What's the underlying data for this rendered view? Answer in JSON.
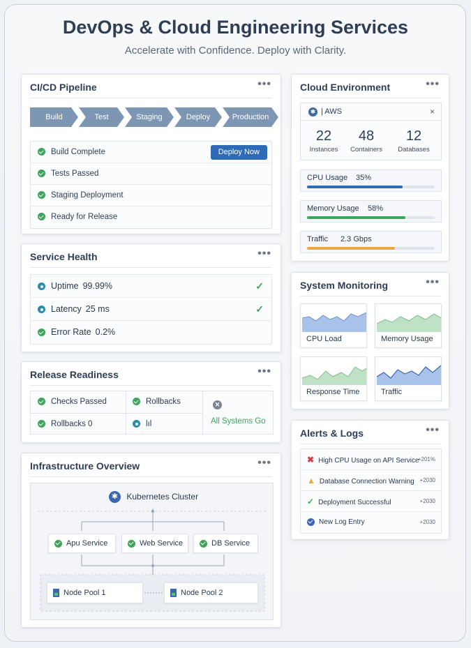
{
  "header": {
    "title": "DevOps & Cloud Engineering Services",
    "subtitle": "Accelerate with Confidence. Deploy with Clarity."
  },
  "pipeline": {
    "title": "CI/CD Pipeline",
    "stages": [
      "Build",
      "Test",
      "Staging",
      "Deploy",
      "Production"
    ],
    "steps": [
      "Build Complete",
      "Tests Passed",
      "Staging Deployment",
      "Ready for Release"
    ],
    "deploy_button": "Deploy Now"
  },
  "health": {
    "title": "Service Health",
    "items": [
      {
        "label": "Uptime",
        "value": "99.99%"
      },
      {
        "label": "Latency",
        "value": "25 ms"
      },
      {
        "label": "Error Rate",
        "value": "0.2%"
      }
    ]
  },
  "release": {
    "title": "Release Readiness",
    "checks_passed": "Checks Passed",
    "rollbacks_label": "Rollbacks",
    "rollbacks_count": "Rollbacks 0",
    "unknown": "lıl",
    "status": "All Systems Go"
  },
  "infra": {
    "title": "Infrastructure Overview",
    "cluster": "Kubernetes Cluster",
    "services": [
      "Apu Service",
      "Web Service",
      "DB Service"
    ],
    "pools": [
      "Node Pool 1",
      "Node Pool 2"
    ]
  },
  "cloud": {
    "title": "Cloud Environment",
    "provider": "| AWS",
    "close": "×",
    "stats": [
      {
        "value": "22",
        "label": "Instances"
      },
      {
        "value": "48",
        "label": "Containers"
      },
      {
        "value": "12",
        "label": "Databases"
      }
    ],
    "usage": [
      {
        "label": "CPU Usage",
        "value": "35%",
        "fill": 0.75,
        "color": "#2f6bb5"
      },
      {
        "label": "Memory Usage",
        "value": "58%",
        "fill": 0.77,
        "color": "#3fa45b"
      },
      {
        "label": "Traffic",
        "value": "2.3 Gbps",
        "fill": 0.69,
        "color": "#e9a93c"
      }
    ]
  },
  "monitoring": {
    "title": "System Monitoring",
    "tiles": [
      "CPU Load",
      "Memory Usage",
      "Response Time",
      "Traffic"
    ]
  },
  "alerts": {
    "title": "Alerts & Logs",
    "items": [
      {
        "text": "High CPU Usage on API Service",
        "time": "+201%"
      },
      {
        "text": "Database Connection Warning",
        "time": "+2030"
      },
      {
        "text": "Deployment Successful",
        "time": "+2030"
      },
      {
        "text": "New Log Entry",
        "time": "+2030"
      }
    ]
  },
  "menu_glyph": "•••"
}
